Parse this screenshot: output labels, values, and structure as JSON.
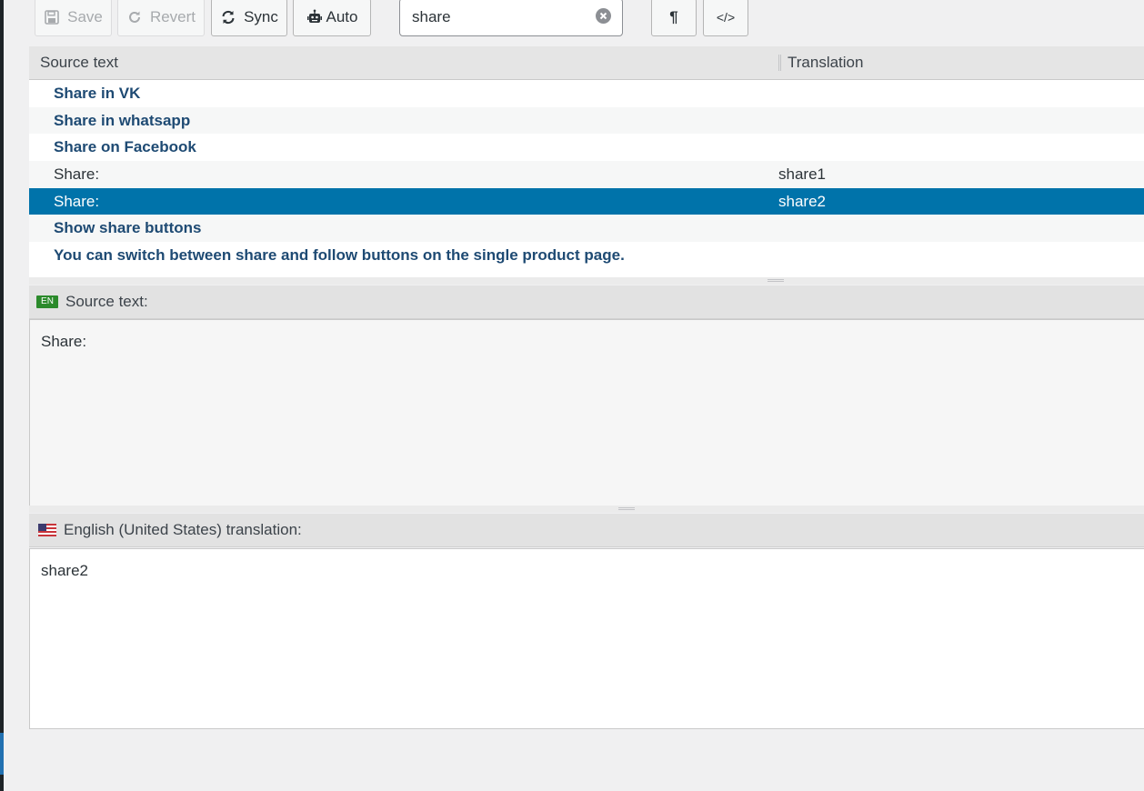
{
  "toolbar": {
    "save_label": "Save",
    "revert_label": "Revert",
    "sync_label": "Sync",
    "auto_label": "Auto",
    "search_value": "share",
    "pilcrow_label": "¶",
    "code_label": "</>"
  },
  "list": {
    "header": {
      "source": "Source text",
      "translation": "Translation"
    },
    "rows": [
      {
        "source": "Share in VK",
        "translation": "",
        "untranslated": true
      },
      {
        "source": "Share in whatsapp",
        "translation": "",
        "untranslated": true
      },
      {
        "source": "Share on Facebook",
        "translation": "",
        "untranslated": true
      },
      {
        "source": "Share:",
        "translation": "share1",
        "untranslated": false
      },
      {
        "source": "Share:",
        "translation": "share2",
        "untranslated": false,
        "selected": true
      },
      {
        "source": "Show share buttons",
        "translation": "",
        "untranslated": true
      },
      {
        "source": "You can switch between share and follow buttons on the single product page.",
        "translation": "",
        "untranslated": true
      }
    ]
  },
  "source_pane": {
    "badge": "EN",
    "title": "Source text:",
    "text": "Share:"
  },
  "target_pane": {
    "flag_icon": "us-flag-icon",
    "title": "English (United States) translation:",
    "text": "share2"
  },
  "colors": {
    "selected_row": "#0073aa",
    "untranslated_text": "#1e4a73",
    "en_badge": "#2b8a2b"
  }
}
